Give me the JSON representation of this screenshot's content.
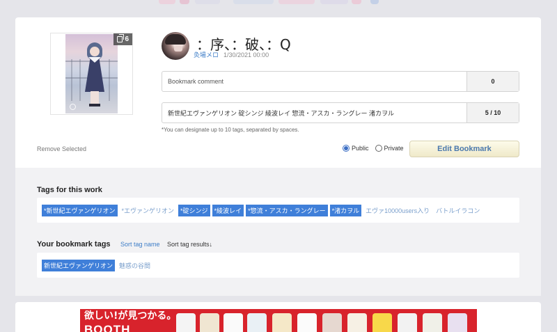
{
  "bookmark": {
    "page_count": "6",
    "title": "：序、：破、：Q",
    "author": "灸場メロ",
    "date": "1/30/2021 00:00",
    "comment_placeholder": "Bookmark comment",
    "comment_count": "0",
    "tags_value": "新世紀エヴァンゲリオン 碇シンジ 綾波レイ 惣流・アスカ・ラングレー 渚カヲル",
    "tags_count": "5 / 10",
    "hint": "*You can designate up to 10 tags, separated by spaces.",
    "remove_selected": "Remove Selected",
    "privacy": {
      "public_label": "Public",
      "private_label": "Private",
      "selected": "Public"
    },
    "edit_button": "Edit Bookmark"
  },
  "work_tags": {
    "heading": "Tags for this work",
    "items": [
      {
        "label": "*新世紀エヴァンゲリオン",
        "selected": true
      },
      {
        "label": "*エヴァンゲリオン",
        "selected": false
      },
      {
        "label": "*碇シンジ",
        "selected": true
      },
      {
        "label": "*綾波レイ",
        "selected": true
      },
      {
        "label": "*惣流・アスカ・ラングレー",
        "selected": true
      },
      {
        "label": "*渚カヲル",
        "selected": true
      },
      {
        "label": "エヴァ10000users入り",
        "selected": false
      },
      {
        "label": "バトルイラコン",
        "selected": false
      }
    ]
  },
  "your_tags": {
    "heading": "Your bookmark tags",
    "sort_by_name": "Sort tag name",
    "sort_by_results": "Sort tag results↓",
    "items": [
      {
        "label": "新世紀エヴァンゲリオン",
        "selected": true
      },
      {
        "label": "魅惑の谷間",
        "selected": false
      }
    ]
  },
  "banner": {
    "tagline": "欲しい!が見つかる。",
    "brand": "BOOTH"
  },
  "colors": {
    "accent_blue": "#3f7fd9",
    "link_blue": "#3d7dc7",
    "banner_red": "#d8232c"
  },
  "icons": {
    "page_count": "multiple-pages-icon"
  }
}
